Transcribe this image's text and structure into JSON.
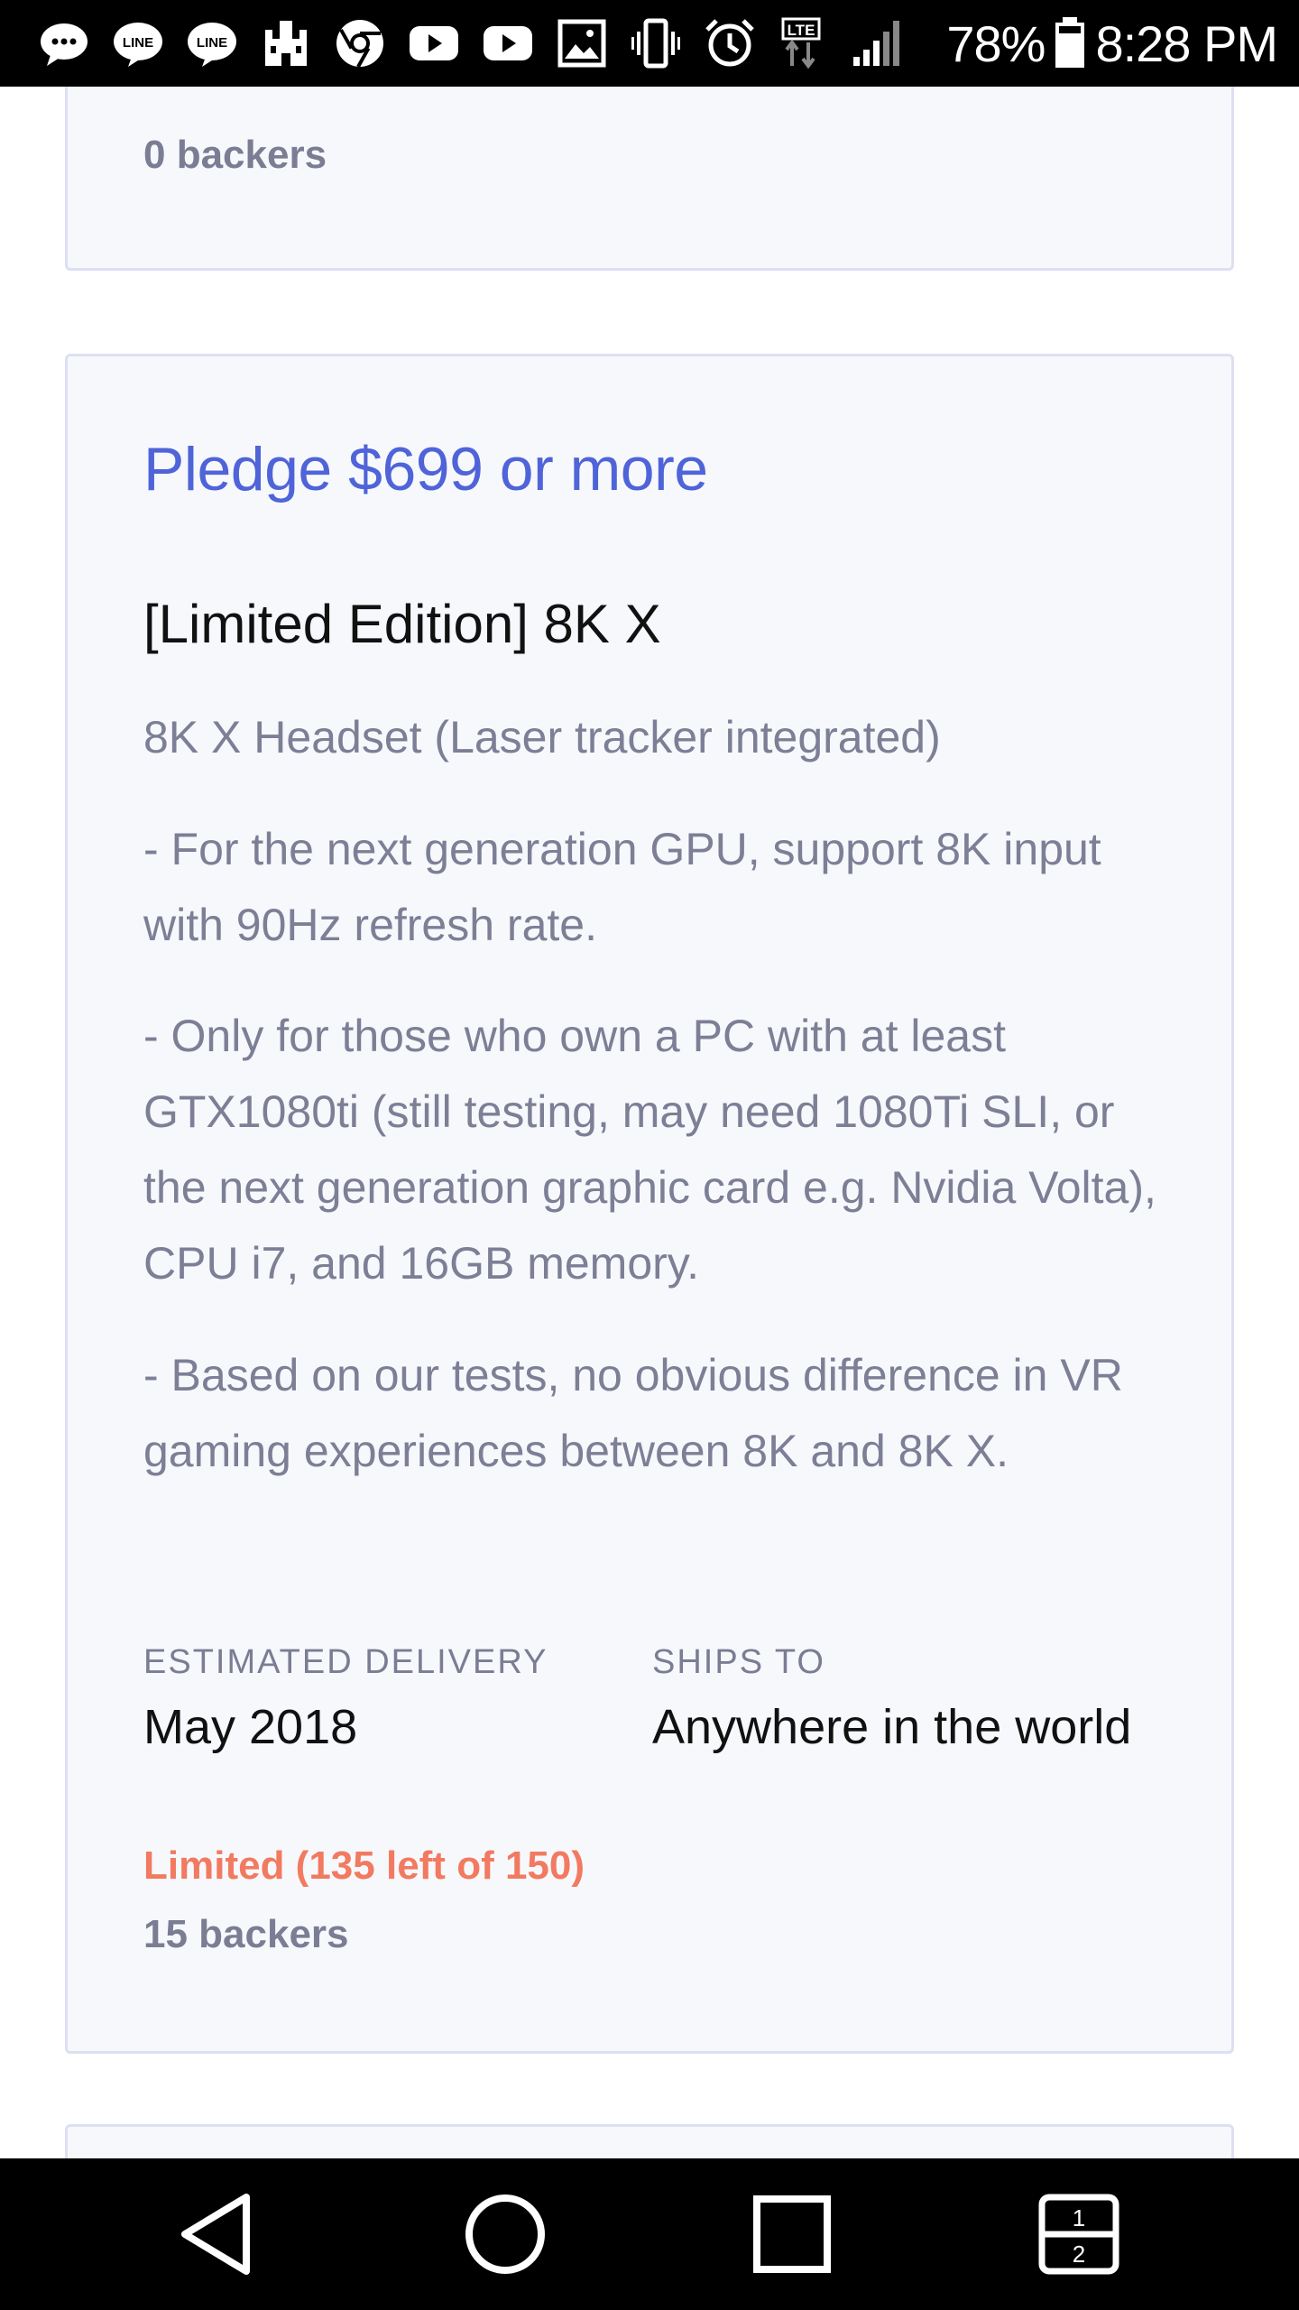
{
  "status_bar": {
    "icons": [
      "more-messages-icon",
      "line-icon",
      "line-icon",
      "castle-icon",
      "chrome-icon",
      "youtube-icon",
      "youtube-icon",
      "gallery-icon",
      "vibrate-icon",
      "alarm-icon",
      "lte-icon",
      "signal-icon"
    ],
    "battery": "78%",
    "time": "8:28 PM"
  },
  "top_card": {
    "backers": "0 backers"
  },
  "reward": {
    "pledge": "Pledge $699 or more",
    "title": "[Limited Edition] 8K X",
    "description": [
      "8K X Headset (Laser tracker integrated)",
      "- For the next generation GPU, support 8K input with 90Hz refresh rate.",
      "- Only for those who own a PC with at least GTX1080ti (still testing, may need 1080Ti SLI, or the next generation graphic card e.g. Nvidia Volta), CPU i7, and 16GB memory.",
      "- Based on our tests, no obvious difference in VR gaming experiences between 8K and 8K X."
    ],
    "delivery_label": "ESTIMATED DELIVERY",
    "delivery_value": "May 2018",
    "ships_label": "SHIPS TO",
    "ships_value": "Anywhere in the world",
    "limited": "Limited (135 left of 150)",
    "backers": "15 backers"
  },
  "nav_bar": {
    "buttons": [
      "back-icon",
      "home-icon",
      "recents-icon",
      "dual-window-icon"
    ],
    "dual_window_numbers": [
      "1",
      "2"
    ]
  },
  "colors": {
    "accent": "#4f64d8",
    "limited": "#f17a61",
    "card_bg": "#f7f8fc",
    "card_border": "#dde0f3"
  }
}
